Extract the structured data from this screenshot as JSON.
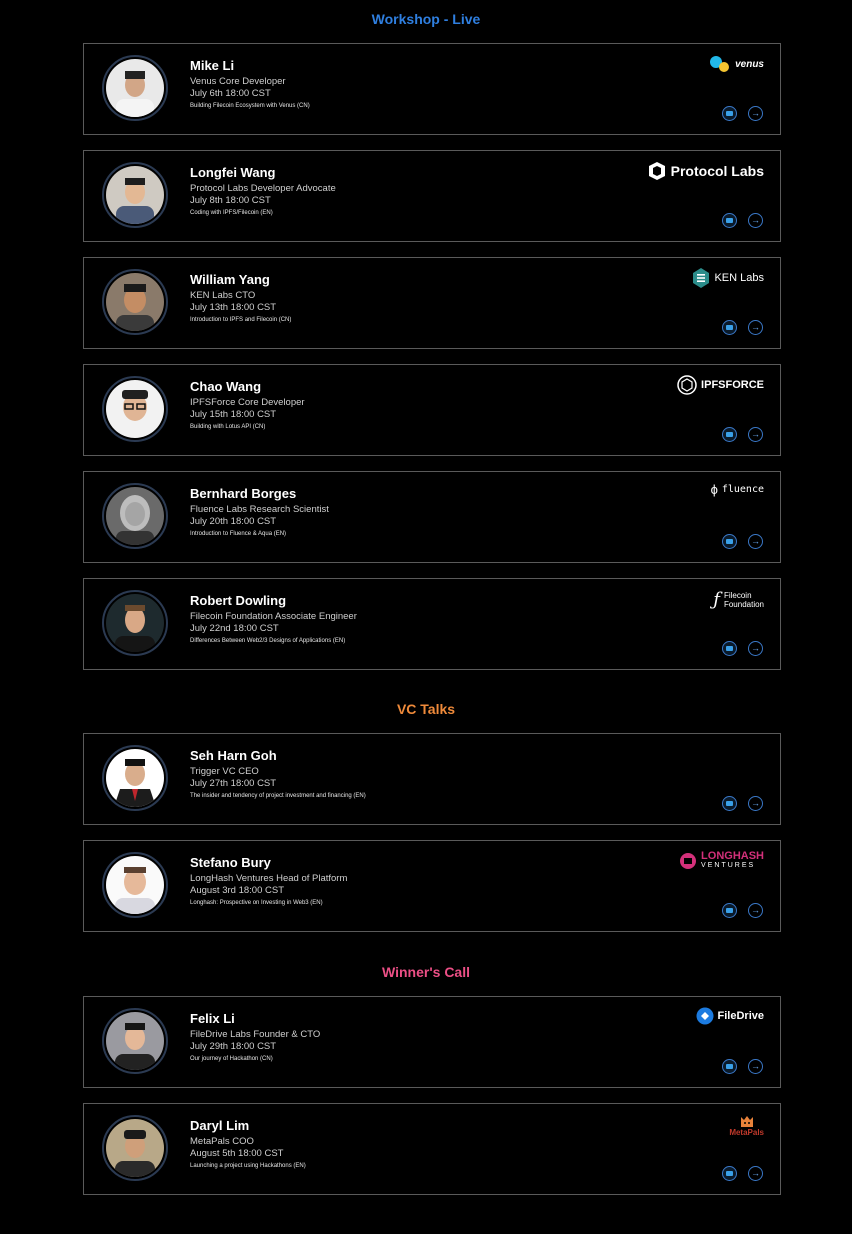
{
  "colors": {
    "workshop": "#2f7fe0",
    "vc": "#ef8a3a",
    "winner": "#ec4f86",
    "border": "#5a5a5a",
    "button_ring": "#3a78c8"
  },
  "sections": {
    "workshop": {
      "title": "Workshop - Live"
    },
    "vc": {
      "title": "VC Talks"
    },
    "winner": {
      "title": "Winner's Call"
    }
  },
  "speakers": [
    {
      "name": "Mike Li",
      "role": "Venus Core Developer",
      "date": "July 6th 18:00 CST",
      "topic": "Building Filecoin Ecosystem with Venus (CN)",
      "logo": "venus"
    },
    {
      "name": "Longfei Wang",
      "role": "Protocol Labs Developer Advocate",
      "date": "July 8th 18:00 CST",
      "topic": "Coding with IPFS/Filecoin (EN)",
      "logo": "Protocol Labs"
    },
    {
      "name": "William Yang",
      "role": "KEN Labs CTO",
      "date": "July 13th 18:00 CST",
      "topic": "Introduction to IPFS and Filecoin (CN)",
      "logo": "KEN Labs"
    },
    {
      "name": "Chao Wang",
      "role": "IPFSForce Core Developer",
      "date": "July 15th 18:00 CST",
      "topic": "Building with Lotus API (CN)",
      "logo": "IPFSFORCE"
    },
    {
      "name": "Bernhard Borges",
      "role": "Fluence Labs Research Scientist",
      "date": "July 20th 18:00 CST",
      "topic": "Introduction to Fluence & Aqua (EN)",
      "logo": "fluence"
    },
    {
      "name": "Robert Dowling",
      "role": "Filecoin Foundation Associate Engineer",
      "date": "July 22nd 18:00 CST",
      "topic": "Differences Between Web2/3 Designs of Applications (EN)",
      "logo_line1": "Filecoin",
      "logo_line2": "Foundation"
    },
    {
      "name": "Seh Harn Goh",
      "role": "Trigger VC CEO",
      "date": "July 27th 18:00 CST",
      "topic": "The insider and tendency of project investment and financing (EN)"
    },
    {
      "name": "Stefano Bury",
      "role": "LongHash Ventures Head of Platform",
      "date": "August 3rd 18:00 CST",
      "topic": "Longhash: Prospective on Investing in Web3 (EN)",
      "logo_line1": "LONGHASH",
      "logo_line2": "VENTURES"
    },
    {
      "name": "Felix Li",
      "role": "FileDrive Labs Founder & CTO",
      "date": "July 29th 18:00 CST",
      "topic": "Our journey of Hackathon (CN)",
      "logo": "FileDrive"
    },
    {
      "name": "Daryl Lim",
      "role": "MetaPals COO",
      "date": "August 5th 18:00 CST",
      "topic": "Launching a project using Hackathons (EN)",
      "logo": "MetaPals"
    }
  ],
  "icons": {
    "video": "youtube-icon",
    "link": "arrow-right-icon"
  }
}
